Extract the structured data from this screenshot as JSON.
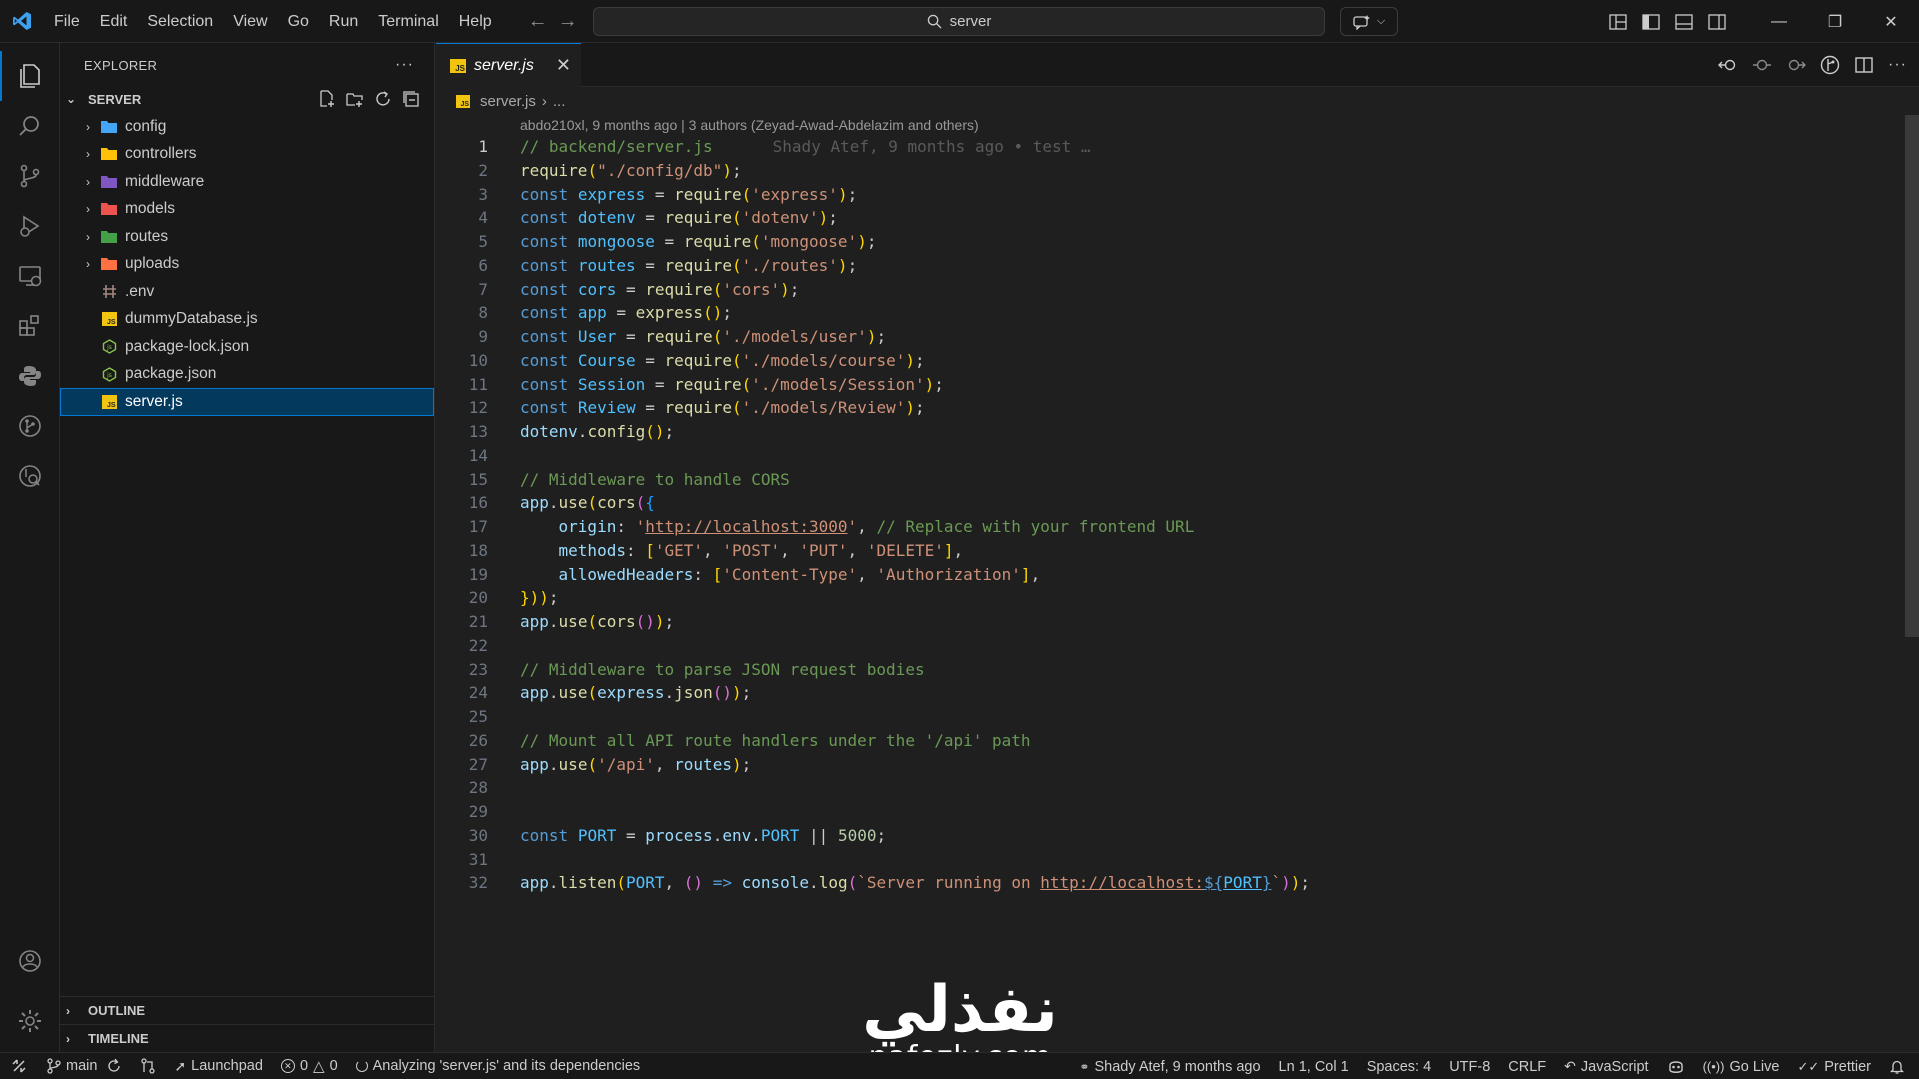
{
  "menu": [
    "File",
    "Edit",
    "Selection",
    "View",
    "Go",
    "Run",
    "Terminal",
    "Help"
  ],
  "command_center": {
    "text": "server"
  },
  "sidebar": {
    "title": "EXPLORER",
    "section": "SERVER",
    "tree": [
      {
        "type": "folder",
        "name": "config",
        "icon": "folder-config-icon",
        "color": "#42a5f5"
      },
      {
        "type": "folder",
        "name": "controllers",
        "icon": "folder-controllers-icon",
        "color": "#ffc107"
      },
      {
        "type": "folder",
        "name": "middleware",
        "icon": "folder-middleware-icon",
        "color": "#7e57c2"
      },
      {
        "type": "folder",
        "name": "models",
        "icon": "folder-models-icon",
        "color": "#ef5350"
      },
      {
        "type": "folder",
        "name": "routes",
        "icon": "folder-routes-icon",
        "color": "#43a047"
      },
      {
        "type": "folder",
        "name": "uploads",
        "icon": "folder-uploads-icon",
        "color": "#ff7043"
      },
      {
        "type": "file",
        "name": ".env",
        "icon": "env-file-icon",
        "color": "#a1887f"
      },
      {
        "type": "file",
        "name": "dummyDatabase.js",
        "icon": "js-file-icon",
        "color": "#f1c40f"
      },
      {
        "type": "file",
        "name": "package-lock.json",
        "icon": "npm-file-icon",
        "color": "#8bc34a"
      },
      {
        "type": "file",
        "name": "package.json",
        "icon": "npm-file-icon",
        "color": "#8bc34a"
      },
      {
        "type": "file",
        "name": "server.js",
        "icon": "js-file-icon",
        "color": "#f1c40f",
        "selected": true
      }
    ],
    "outline": "OUTLINE",
    "timeline": "TIMELINE"
  },
  "editor": {
    "tab": {
      "label": "server.js"
    },
    "breadcrumb": {
      "file": "server.js",
      "rest": "..."
    },
    "blame_header": "abdo210xl, 9 months ago | 3 authors (Zeyad-Awad-Abdelazim and others)",
    "inline_blame": "Shady Atef, 9 months ago • test …",
    "lines": [
      "// backend/server.js",
      "require(\"./config/db\");",
      "const express = require('express');",
      "const dotenv = require('dotenv');",
      "const mongoose = require('mongoose');",
      "const routes = require('./routes');",
      "const cors = require('cors');",
      "const app = express();",
      "const User = require('./models/user');",
      "const Course = require('./models/course');",
      "const Session = require('./models/Session');",
      "const Review = require('./models/Review');",
      "dotenv.config();",
      "",
      "// Middleware to handle CORS",
      "app.use(cors({",
      "    origin: 'http://localhost:3000', // Replace with your frontend URL",
      "    methods: ['GET', 'POST', 'PUT', 'DELETE'],",
      "    allowedHeaders: ['Content-Type', 'Authorization'],",
      "}));",
      "app.use(cors());",
      "",
      "// Middleware to parse JSON request bodies",
      "app.use(express.json());",
      "",
      "// Mount all API route handlers under the '/api' path",
      "app.use('/api', routes);",
      "",
      "",
      "const PORT = process.env.PORT || 5000;",
      "",
      "app.listen(PORT, () => console.log(`Server running on http://localhost:${PORT}`));"
    ]
  },
  "status": {
    "branch": "main",
    "launchpad": "Launchpad",
    "errors": "0",
    "warnings": "0",
    "analyzing": "Analyzing 'server.js' and its dependencies",
    "blame": "Shady Atef, 9 months ago",
    "position": "Ln 1, Col 1",
    "spaces": "Spaces: 4",
    "encoding": "UTF-8",
    "eol": "CRLF",
    "language": "JavaScript",
    "golive": "Go Live",
    "prettier": "Prettier"
  },
  "watermark": {
    "arabic": "نفذلي",
    "latin": "nafezly.com"
  },
  "colors": {
    "accent": "#0078d4",
    "selection": "#04395e",
    "background": "#1f1f1f"
  }
}
